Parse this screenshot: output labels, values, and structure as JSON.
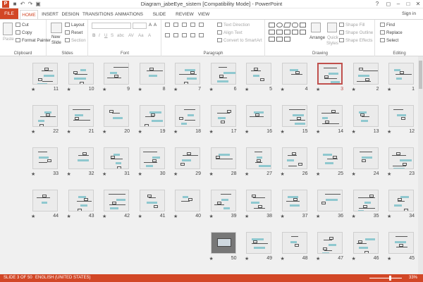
{
  "app": {
    "title": "Diagram_jabeEye_sistem [Compatibility Mode] - PowerPoint",
    "icon": "powerpoint-app-icon",
    "sign_in": "Sign in",
    "qa_save": "save-icon",
    "qa_undo": "undo-icon",
    "qa_redo": "redo-icon",
    "qa_present": "present-icon"
  },
  "tabs": [
    {
      "label": "FILE"
    },
    {
      "label": "HOME"
    },
    {
      "label": "INSERT"
    },
    {
      "label": "DESIGN"
    },
    {
      "label": "TRANSITIONS"
    },
    {
      "label": "ANIMATIONS"
    },
    {
      "label": "SLIDE SHOW"
    },
    {
      "label": "REVIEW"
    },
    {
      "label": "VIEW"
    }
  ],
  "ribbon": {
    "clipboard": {
      "label": "Clipboard",
      "paste": "Paste",
      "cut": "Cut",
      "copy": "Copy",
      "format_painter": "Format Painter"
    },
    "slides": {
      "label": "Slides",
      "new_slide": "New",
      "new_slide_2": "Slide",
      "layout": "Layout",
      "reset": "Reset",
      "section": "Section"
    },
    "font": {
      "label": "Font"
    },
    "paragraph": {
      "label": "Paragraph",
      "text_direction": "Text Direction",
      "align_text": "Align Text",
      "convert": "Convert to SmartArt"
    },
    "drawing": {
      "label": "Drawing",
      "arrange": "Arrange",
      "quick_styles": "Quick",
      "quick_styles_2": "Styles",
      "shape_fill": "Shape Fill",
      "shape_outline": "Shape Outline",
      "shape_effects": "Shape Effects"
    },
    "editing": {
      "label": "Editing",
      "find": "Find",
      "replace": "Replace",
      "select": "Select"
    }
  },
  "slides": {
    "selected": "3",
    "rows": [
      [
        "11",
        "10",
        "9",
        "8",
        "7",
        "6",
        "5",
        "4",
        "3",
        "2",
        "1"
      ],
      [
        "22",
        "21",
        "20",
        "19",
        "18",
        "17",
        "16",
        "15",
        "14",
        "13",
        "12"
      ],
      [
        "33",
        "32",
        "31",
        "30",
        "29",
        "28",
        "27",
        "26",
        "25",
        "24",
        "23"
      ],
      [
        "44",
        "43",
        "42",
        "41",
        "40",
        "39",
        "38",
        "37",
        "36",
        "35",
        "34"
      ],
      [
        "",
        "",
        "",
        "",
        "",
        "50",
        "49",
        "48",
        "47",
        "46",
        "45"
      ]
    ]
  },
  "status": {
    "slide": "SLIDE 3 OF 50",
    "language": "ENGLISH (UNITED STATES)",
    "zoom": "33%"
  },
  "colors": {
    "accent": "#d24726",
    "selection": "#c0504d"
  }
}
